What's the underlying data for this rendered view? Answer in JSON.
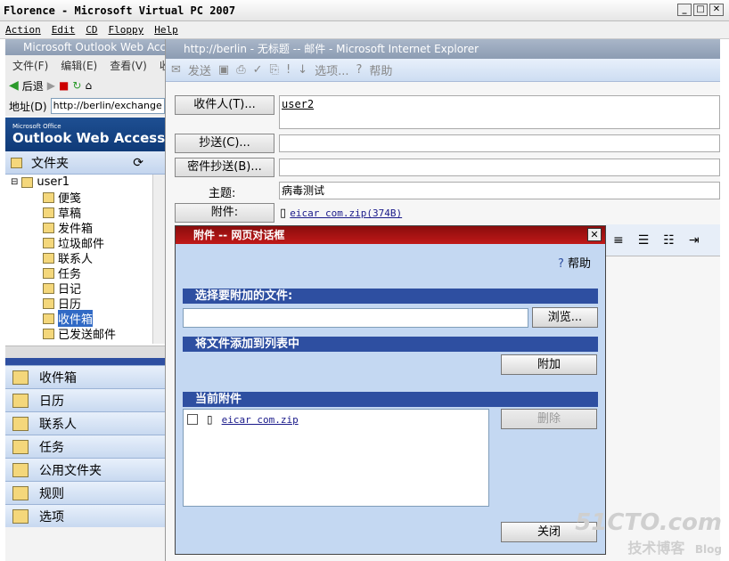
{
  "vpc": {
    "title": "Florence - Microsoft Virtual PC 2007",
    "menu": [
      "Action",
      "Edit",
      "CD",
      "Floppy",
      "Help"
    ],
    "buttons": [
      "_",
      "□",
      "✕"
    ]
  },
  "owa": {
    "window_title": "Microsoft Outlook Web Acce",
    "menu": [
      "文件(F)",
      "编辑(E)",
      "查看(V)",
      "收"
    ],
    "back_label": "后退",
    "address_label": "地址(D)",
    "address_value": "http://berlin/exchange",
    "brand_small": "Microsoft Office",
    "brand": "Outlook Web Access",
    "folders_header": "文件夹",
    "tree": {
      "root": "user1",
      "items": [
        "便笺",
        "草稿",
        "发件箱",
        "垃圾邮件",
        "联系人",
        "任务",
        "日记",
        "日历",
        "收件箱",
        "已发送邮件"
      ],
      "selected_index": 8
    },
    "nav_buttons": [
      "收件箱",
      "日历",
      "联系人",
      "任务",
      "公用文件夹",
      "规则",
      "选项"
    ]
  },
  "mail": {
    "window_title": "http://berlin - 无标题 -- 邮件 - Microsoft Internet Explorer",
    "toolbar": {
      "send": "发送",
      "options": "选项...",
      "help": "帮助"
    },
    "to_button": "收件人(T)...",
    "to_value": "user2",
    "cc_button": "抄送(C)...",
    "bcc_button": "密件抄送(B)...",
    "subject_label": "主题:",
    "subject_value": "病毒测试",
    "attach_label": "附件:",
    "attach_link": "eicar com.zip(374B)"
  },
  "dialog": {
    "title": "附件 -- 网页对话框",
    "help": "帮助",
    "choose_section": "选择要附加的文件:",
    "file_input_value": "",
    "browse_button": "浏览...",
    "add_section": "将文件添加到列表中",
    "attach_button": "附加",
    "current_section": "当前附件",
    "attachments": [
      {
        "name": "eicar com.zip",
        "checked": false
      }
    ],
    "delete_button": "删除",
    "close_button": "关闭"
  },
  "watermark": {
    "line1": "51CTO.com",
    "line2": "技术博客",
    "line3": "Blog"
  }
}
